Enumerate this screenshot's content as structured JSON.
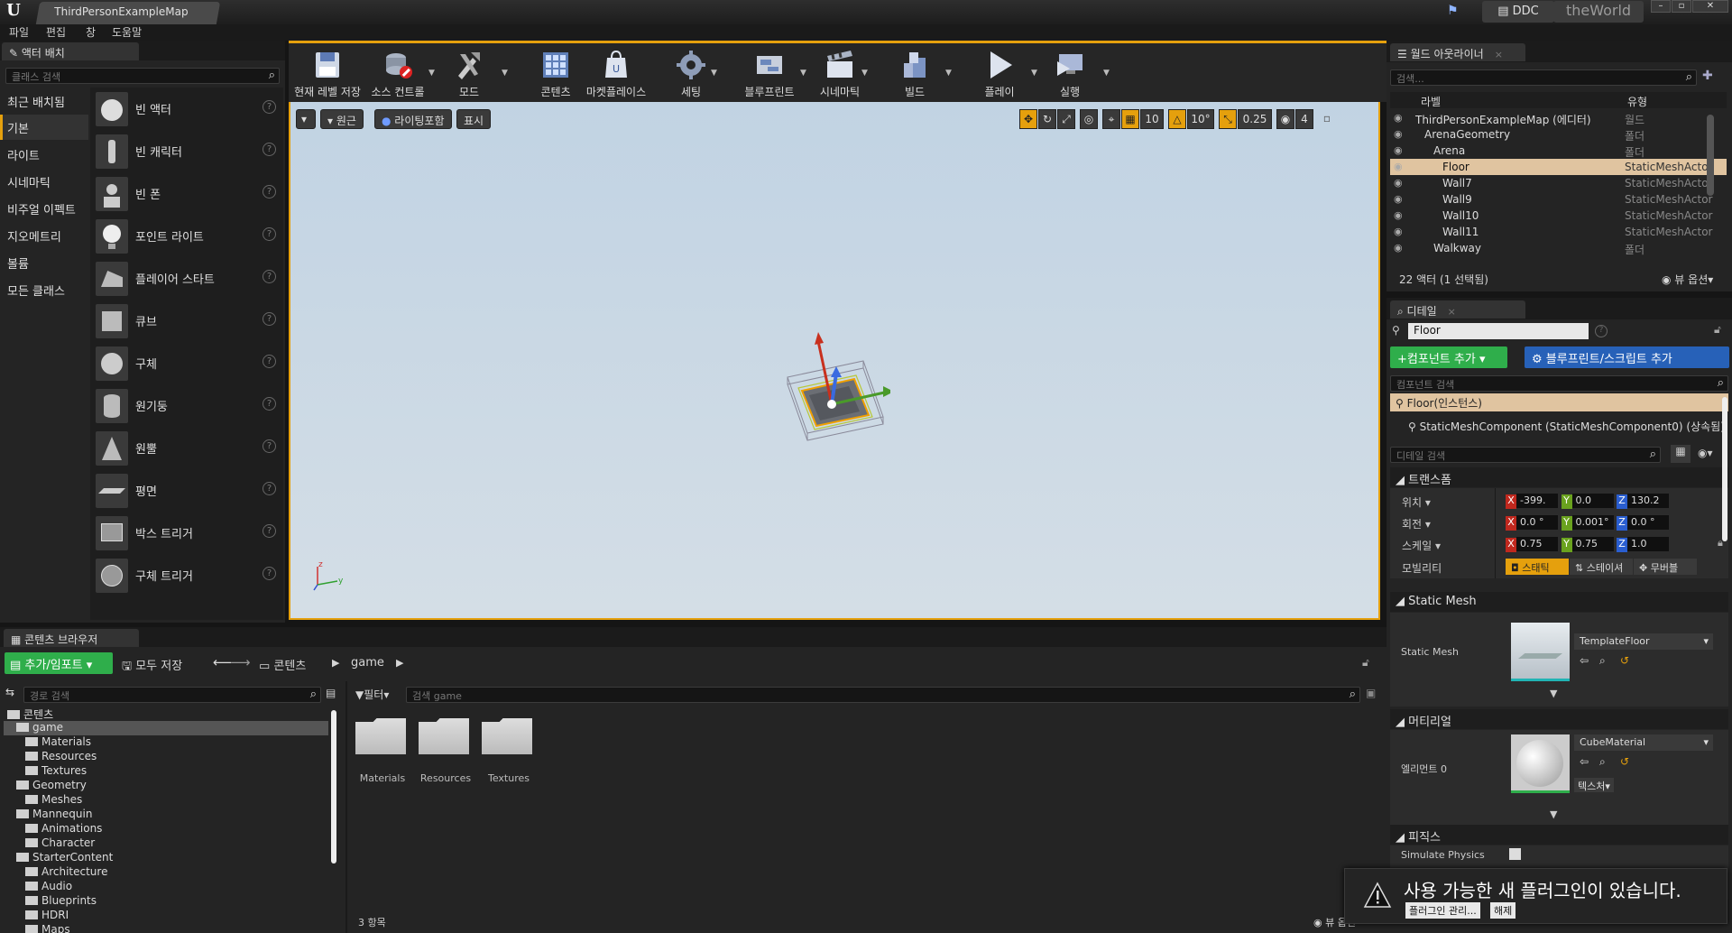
{
  "title_bar": {
    "map_tab": "ThirdPersonExampleMap",
    "ddc": "DDC",
    "world": "theWorld"
  },
  "menu": [
    "파일",
    "편집",
    "창",
    "도움말"
  ],
  "place_actors": {
    "tab": "액터 배치",
    "search_placeholder": "클래스 검색",
    "categories": [
      "최근 배치됨",
      "기본",
      "라이트",
      "시네마틱",
      "비주얼 이펙트",
      "지오메트리",
      "볼륨",
      "모든 클래스"
    ],
    "actors": [
      "빈 액터",
      "빈 캐릭터",
      "빈 폰",
      "포인트 라이트",
      "플레이어 스타트",
      "큐브",
      "구체",
      "원기둥",
      "원뿔",
      "평면",
      "박스 트리거",
      "구체 트리거"
    ]
  },
  "toolbar": {
    "buttons": [
      "현재 레벨 저장",
      "소스 컨트롤",
      "모드",
      "콘텐츠",
      "마켓플레이스",
      "세팅",
      "블루프린트",
      "시네마틱",
      "빌드",
      "플레이",
      "실행"
    ]
  },
  "viewport": {
    "perspective": "원근",
    "lighting": "라이팅포함",
    "show": "표시",
    "grid_snap": "10",
    "rotation_snap": "10°",
    "scale_snap": "0.25",
    "camera_speed": "4"
  },
  "outliner": {
    "tab": "월드 아웃라이너",
    "search_placeholder": "검색...",
    "col_label": "라벨",
    "col_type": "유형",
    "rows": [
      {
        "name": "ThirdPersonExampleMap (에디터)",
        "type": "월드",
        "indent": 0
      },
      {
        "name": "ArenaGeometry",
        "type": "폴더",
        "indent": 1
      },
      {
        "name": "Arena",
        "type": "폴더",
        "indent": 2
      },
      {
        "name": "Floor",
        "type": "StaticMeshActor",
        "indent": 3,
        "selected": true
      },
      {
        "name": "Wall7",
        "type": "StaticMeshActor",
        "indent": 3
      },
      {
        "name": "Wall9",
        "type": "StaticMeshActor",
        "indent": 3
      },
      {
        "name": "Wall10",
        "type": "StaticMeshActor",
        "indent": 3
      },
      {
        "name": "Wall11",
        "type": "StaticMeshActor",
        "indent": 3
      },
      {
        "name": "Walkway",
        "type": "폴더",
        "indent": 2
      }
    ],
    "status": "22 액터 (1 선택됨)",
    "view_options": "뷰 옵션"
  },
  "details": {
    "tab": "디테일",
    "name": "Floor",
    "add_component": "+컴포넌트 추가",
    "add_blueprint": "블루프린트/스크립트 추가",
    "component_search_placeholder": "컴포넌트 검색",
    "instance": "Floor(인스턴스)",
    "component": "StaticMeshComponent (StaticMeshComponent0) (상속됨)",
    "detail_search_placeholder": "디테일 검색",
    "transform": {
      "header": "트랜스폼",
      "location_label": "위치",
      "rotation_label": "회전",
      "scale_label": "스케일",
      "mobility_label": "모빌리티",
      "location": [
        "-399.",
        "0.0",
        "130.2"
      ],
      "rotation": [
        "0.0 °",
        "0.001°",
        "0.0 °"
      ],
      "scale": [
        "0.75",
        "0.75",
        "1.0"
      ],
      "mobility": [
        "스태틱",
        "스테이셔",
        "무버블"
      ]
    },
    "static_mesh": {
      "header": "Static Mesh",
      "label": "Static Mesh",
      "value": "TemplateFloor"
    },
    "materials": {
      "header": "머티리얼",
      "label": "엘리먼트 0",
      "value": "CubeMaterial",
      "texture": "텍스처"
    },
    "physics": {
      "header": "피직스",
      "simulate": "Simulate Physics"
    }
  },
  "content_browser": {
    "tab": "콘텐츠 브라우저",
    "add_import": "추가/임포트",
    "save_all": "모두 저장",
    "path_root": "콘텐츠",
    "path_child": "game",
    "path_search_placeholder": "경로 검색",
    "filter": "필터",
    "asset_search_placeholder": "검색 game",
    "tree": [
      {
        "name": "콘텐츠",
        "indent": 0
      },
      {
        "name": "game",
        "indent": 1,
        "selected": true
      },
      {
        "name": "Materials",
        "indent": 2
      },
      {
        "name": "Resources",
        "indent": 2
      },
      {
        "name": "Textures",
        "indent": 2
      },
      {
        "name": "Geometry",
        "indent": 1
      },
      {
        "name": "Meshes",
        "indent": 2
      },
      {
        "name": "Mannequin",
        "indent": 1
      },
      {
        "name": "Animations",
        "indent": 2
      },
      {
        "name": "Character",
        "indent": 2
      },
      {
        "name": "StarterContent",
        "indent": 1
      },
      {
        "name": "Architecture",
        "indent": 2
      },
      {
        "name": "Audio",
        "indent": 2
      },
      {
        "name": "Blueprints",
        "indent": 2
      },
      {
        "name": "HDRI",
        "indent": 2
      },
      {
        "name": "Maps",
        "indent": 2
      }
    ],
    "assets": [
      "Materials",
      "Resources",
      "Textures"
    ],
    "item_count": "3 항목",
    "view_options": "뷰 옵션"
  },
  "notification": {
    "message": "사용 가능한 새 플러그인이 있습니다.",
    "manage": "플러그인 관리...",
    "dismiss": "해제"
  }
}
